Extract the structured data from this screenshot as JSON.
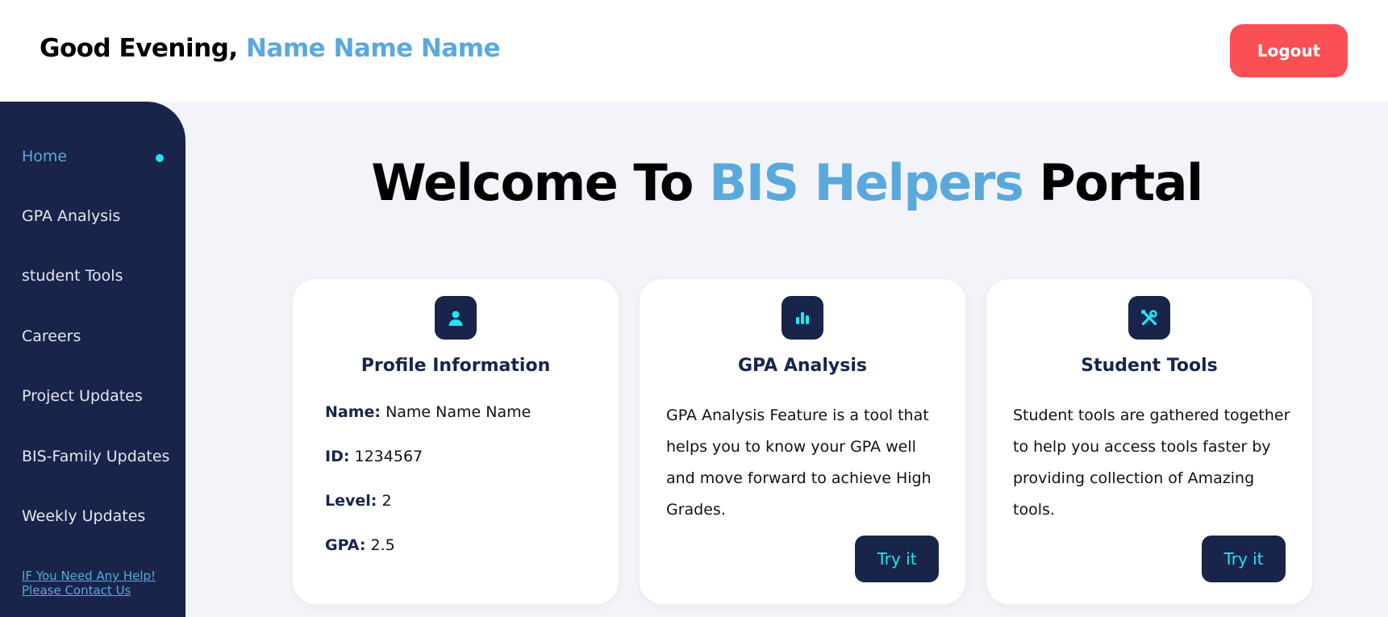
{
  "header": {
    "greeting_prefix": "Good Evening, ",
    "user_name": "Name Name Name",
    "logout_label": "Logout"
  },
  "sidebar": {
    "items": [
      {
        "label": "Home",
        "active": true
      },
      {
        "label": "GPA Analysis"
      },
      {
        "label": "student Tools"
      },
      {
        "label": "Careers"
      },
      {
        "label": "Project Updates"
      },
      {
        "label": "BIS-Family Updates"
      },
      {
        "label": "Weekly Updates"
      }
    ],
    "help_line1": "IF You Need Any Help!",
    "help_line2": "Please Contact Us"
  },
  "welcome": {
    "prefix": "Welcome To ",
    "accent": "BIS Helpers",
    "suffix": " Portal"
  },
  "profile_card": {
    "icon": "user-icon",
    "title": "Profile Information",
    "name_label": "Name:",
    "name_value": "Name Name Name",
    "id_label": "ID:",
    "id_value": "1234567",
    "level_label": "Level:",
    "level_value": "2",
    "gpa_label": "GPA:",
    "gpa_value": "2.5"
  },
  "gpa_card": {
    "icon": "bar-chart-icon",
    "title": "GPA Analysis",
    "description": "GPA Analysis Feature is a tool that helps you to know your GPA well and move forward to achieve High Grades.",
    "button_label": "Try it"
  },
  "tools_card": {
    "icon": "tools-icon",
    "title": "Student Tools",
    "description": "Student tools are gathered together to help you access tools faster by providing collection of Amazing tools.",
    "button_label": "Try it"
  },
  "colors": {
    "navy": "#18244a",
    "accent_blue": "#5aa9dc",
    "cyan": "#22e4f4",
    "logout_red": "#f94f55",
    "background": "#f3f4f9"
  }
}
